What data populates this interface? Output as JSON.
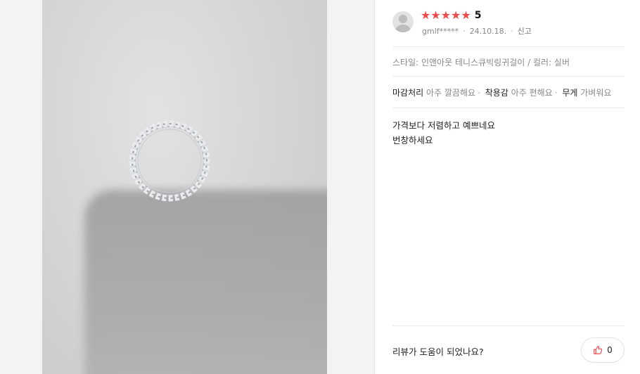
{
  "review": {
    "rating_stars": 5,
    "score": "5",
    "username": "gmlf*****",
    "date": "24.10.18.",
    "report_label": "신고",
    "option_text": "스타일: 인앤아웃 테니스큐빅링귀걸이 / 컬러: 실버",
    "attributes": [
      {
        "key": "마감처리",
        "value": "아주 깔끔해요"
      },
      {
        "key": "착용감",
        "value": "아주 편해요"
      },
      {
        "key": "무게",
        "value": "가벼워요"
      }
    ],
    "body_lines": [
      "가격보다 저렴하고 예쁘네요",
      "번창하세요"
    ],
    "helpful_question": "리뷰가 도움이 되었나요?",
    "like_count": "0"
  },
  "colors": {
    "star": "#f0494c",
    "divider": "#ebebeb"
  },
  "icons": {
    "avatar": "user-avatar-icon",
    "star": "star-icon",
    "like": "thumbs-up-icon"
  }
}
